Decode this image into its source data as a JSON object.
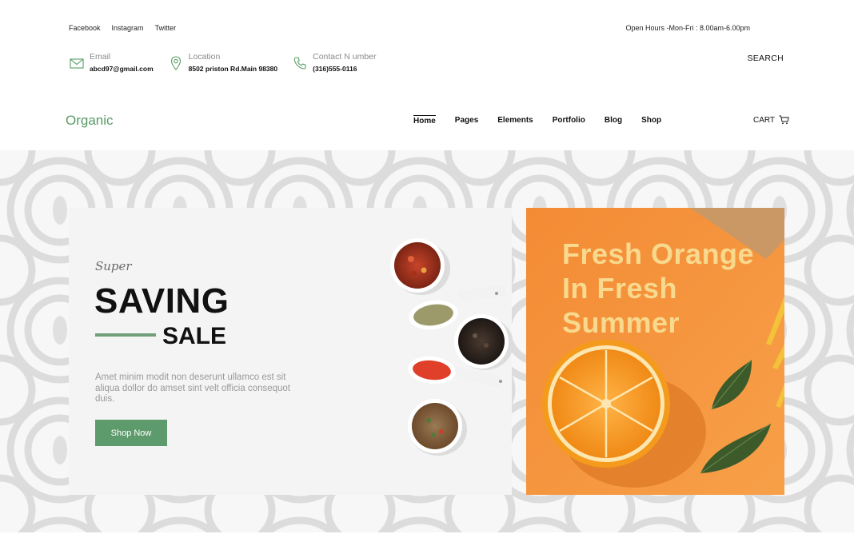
{
  "topbar": {
    "social": [
      "Facebook",
      "Instagram",
      "Twitter"
    ],
    "hours": "Open Hours -Mon-Fri : 8.00am-6.00pm"
  },
  "contact": {
    "email": {
      "label": "Email",
      "value": "abcd97@gmail.com",
      "icon": "mail-icon"
    },
    "location": {
      "label": "Location",
      "value": "8502 priston Rd.Main 98380",
      "icon": "map-pin-icon"
    },
    "phone": {
      "label": "Contact N umber",
      "value": "(316)555-0116",
      "icon": "phone-icon"
    },
    "search_label": "SEARCH"
  },
  "header": {
    "logo": "Organic",
    "nav": [
      "Home",
      "Pages",
      "Elements",
      "Portfolio",
      "Blog",
      "Shop"
    ],
    "active_nav": "Home",
    "cart_label": "CART",
    "cart_icon": "cart-icon"
  },
  "hero": {
    "left": {
      "kicker": "Super",
      "title": "SAVING",
      "subtitle": "SALE",
      "description": "Amet minim modit non deserunt ullamco est sit aliqua dollor do amset sint velt officia consequot duis.",
      "button_label": "Shop Now"
    },
    "right": {
      "lines": [
        "Fresh Orange",
        "In Fresh",
        "Summer"
      ]
    }
  },
  "colors": {
    "brand_green": "#5a9b66",
    "button_green": "#5e9b6c",
    "orange_bg": "#f6903a",
    "promo_text": "#f8d98d",
    "hero_bg": "#efefef"
  }
}
